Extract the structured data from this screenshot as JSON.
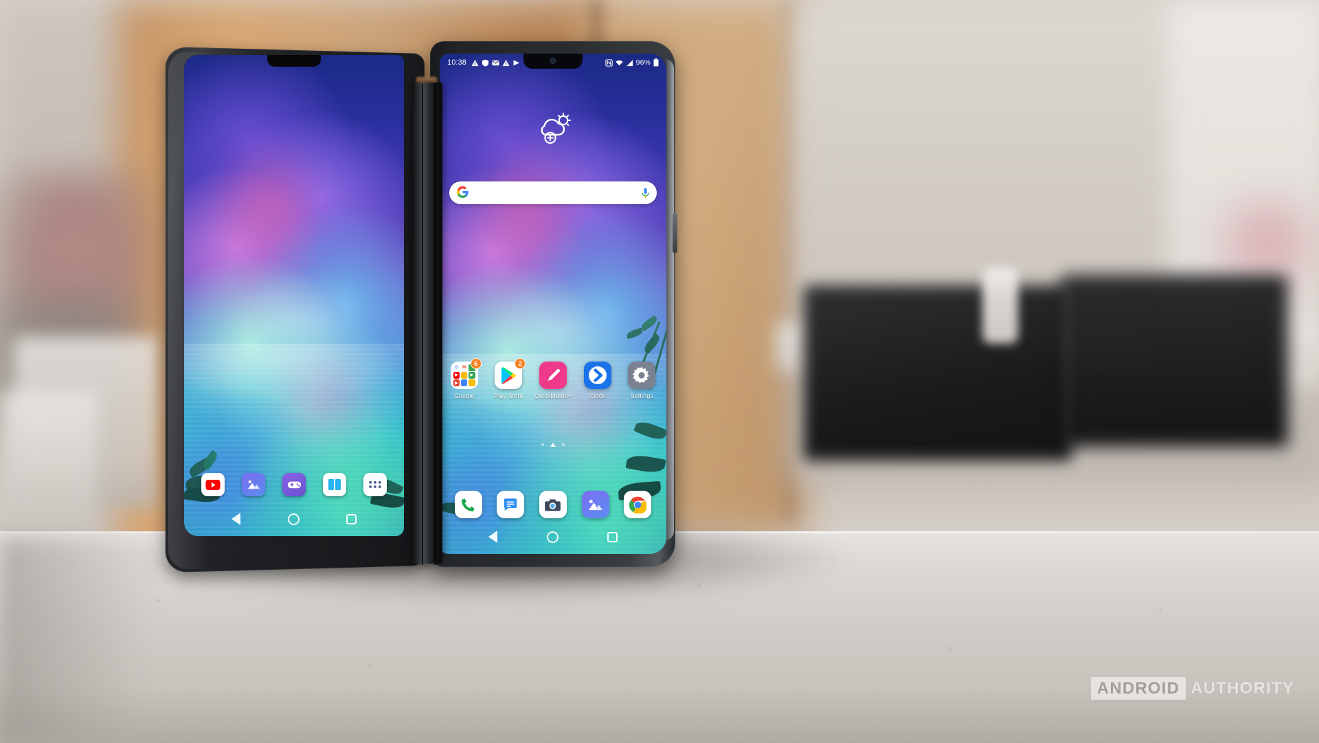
{
  "scene": {
    "description": "LG G8X ThinQ dual screen phone standing on a white desk",
    "watermark": {
      "boxed_word": "ANDROID",
      "plain_word": "AUTHORITY"
    }
  },
  "colors": {
    "status_text": "#ffffff",
    "badge": "#f58220",
    "search_bar": "#ffffff",
    "play_store_bg": "#ffffff",
    "quickmemo_bg": "#ef3a8c",
    "clock_bg": "#1a73e8",
    "settings_bg": "#7a8190",
    "phone_bg": "#2b2e31",
    "google_blue": "#4285f4",
    "google_red": "#ea4335",
    "google_yellow": "#fbbc05",
    "google_green": "#34a853"
  },
  "main_screen": {
    "status_bar": {
      "time": "10:38",
      "left_icons": [
        "warning-triangle-icon",
        "shield-icon",
        "gmail-icon",
        "warning-triangle-icon",
        "play-icon"
      ],
      "right_icons": [
        "nfc-icon",
        "wifi-icon",
        "cellular-signal-icon"
      ],
      "battery_percent": "96%",
      "battery_icon": "battery-full-icon"
    },
    "weather_widget": {
      "icon": "cloud-sun-add-icon"
    },
    "search_bar": {
      "logo": "google-g-icon",
      "placeholder": "",
      "value": "",
      "mic": "microphone-icon"
    },
    "apps": [
      {
        "name": "Google",
        "icon": "google-folder-icon",
        "badge": "6"
      },
      {
        "name": "Play Store",
        "icon": "play-store-icon",
        "badge": "2"
      },
      {
        "name": "QuickMemo+",
        "icon": "pencil-icon",
        "badge": ""
      },
      {
        "name": "Clock",
        "icon": "clock-chevron-icon",
        "badge": ""
      },
      {
        "name": "Settings",
        "icon": "gear-icon",
        "badge": ""
      }
    ],
    "page_indicator": {
      "pages": 3,
      "current": 2
    },
    "dock": [
      {
        "name": "Phone",
        "icon": "phone-handset-icon"
      },
      {
        "name": "Messages",
        "icon": "message-bubble-icon"
      },
      {
        "name": "Camera",
        "icon": "camera-icon"
      },
      {
        "name": "Gallery",
        "icon": "gallery-mountain-icon"
      },
      {
        "name": "Chrome",
        "icon": "chrome-icon"
      }
    ],
    "nav_bar": [
      {
        "name": "Back",
        "icon": "nav-back-icon"
      },
      {
        "name": "Home",
        "icon": "nav-home-icon"
      },
      {
        "name": "Recents",
        "icon": "nav-recents-icon"
      }
    ]
  },
  "cover_screen": {
    "dock": [
      {
        "name": "YouTube",
        "icon": "youtube-icon"
      },
      {
        "name": "Gallery",
        "icon": "gallery-mountain-icon"
      },
      {
        "name": "Game Pad",
        "icon": "gamepad-icon"
      },
      {
        "name": "Dual Screen",
        "icon": "dual-screen-icon"
      },
      {
        "name": "App Drawer",
        "icon": "app-drawer-icon"
      }
    ],
    "nav_bar": [
      {
        "name": "Back",
        "icon": "nav-back-icon"
      },
      {
        "name": "Home",
        "icon": "nav-home-icon"
      },
      {
        "name": "Recents",
        "icon": "nav-recents-icon"
      }
    ]
  }
}
